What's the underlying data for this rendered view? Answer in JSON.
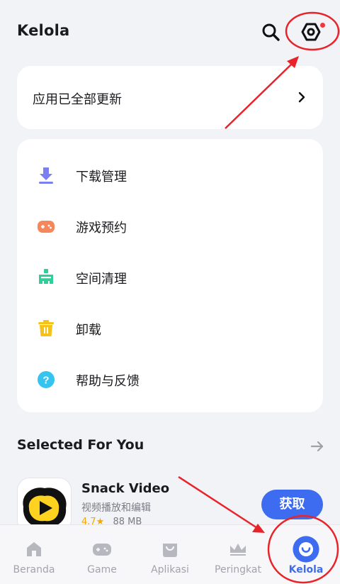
{
  "header": {
    "title": "Kelola",
    "search_icon": "search-icon",
    "settings_icon": "settings-hexagon-icon"
  },
  "update_card": {
    "label": "应用已全部更新",
    "icon": "chevron-right-icon"
  },
  "menu": {
    "items": [
      {
        "label": "下载管理",
        "icon": "download-icon",
        "color": "#7b7ff0"
      },
      {
        "label": "游戏预约",
        "icon": "gamepad-icon",
        "color": "#f5875a"
      },
      {
        "label": "空间清理",
        "icon": "clean-icon",
        "color": "#2fcf9a"
      },
      {
        "label": "卸载",
        "icon": "trash-icon",
        "color": "#f6c21a"
      },
      {
        "label": "帮助与反馈",
        "icon": "help-icon",
        "color": "#35c4f0"
      }
    ]
  },
  "section": {
    "title": "Selected For You",
    "arrow_icon": "arrow-right-icon"
  },
  "app": {
    "name": "Snack Video",
    "description": "视频播放和编辑",
    "rating": "4.7★",
    "size": "88 MB",
    "button_label": "获取"
  },
  "tabs": [
    {
      "label": "Beranda",
      "icon": "home-icon",
      "active": false
    },
    {
      "label": "Game",
      "icon": "game-icon",
      "active": false
    },
    {
      "label": "Aplikasi",
      "icon": "bag-icon",
      "active": false
    },
    {
      "label": "Peringkat",
      "icon": "crown-icon",
      "active": false
    },
    {
      "label": "Kelola",
      "icon": "manage-icon",
      "active": true
    }
  ],
  "colors": {
    "accent": "#3d6cf0",
    "annotation": "#e8242a",
    "notification_dot": "#f0373c"
  }
}
